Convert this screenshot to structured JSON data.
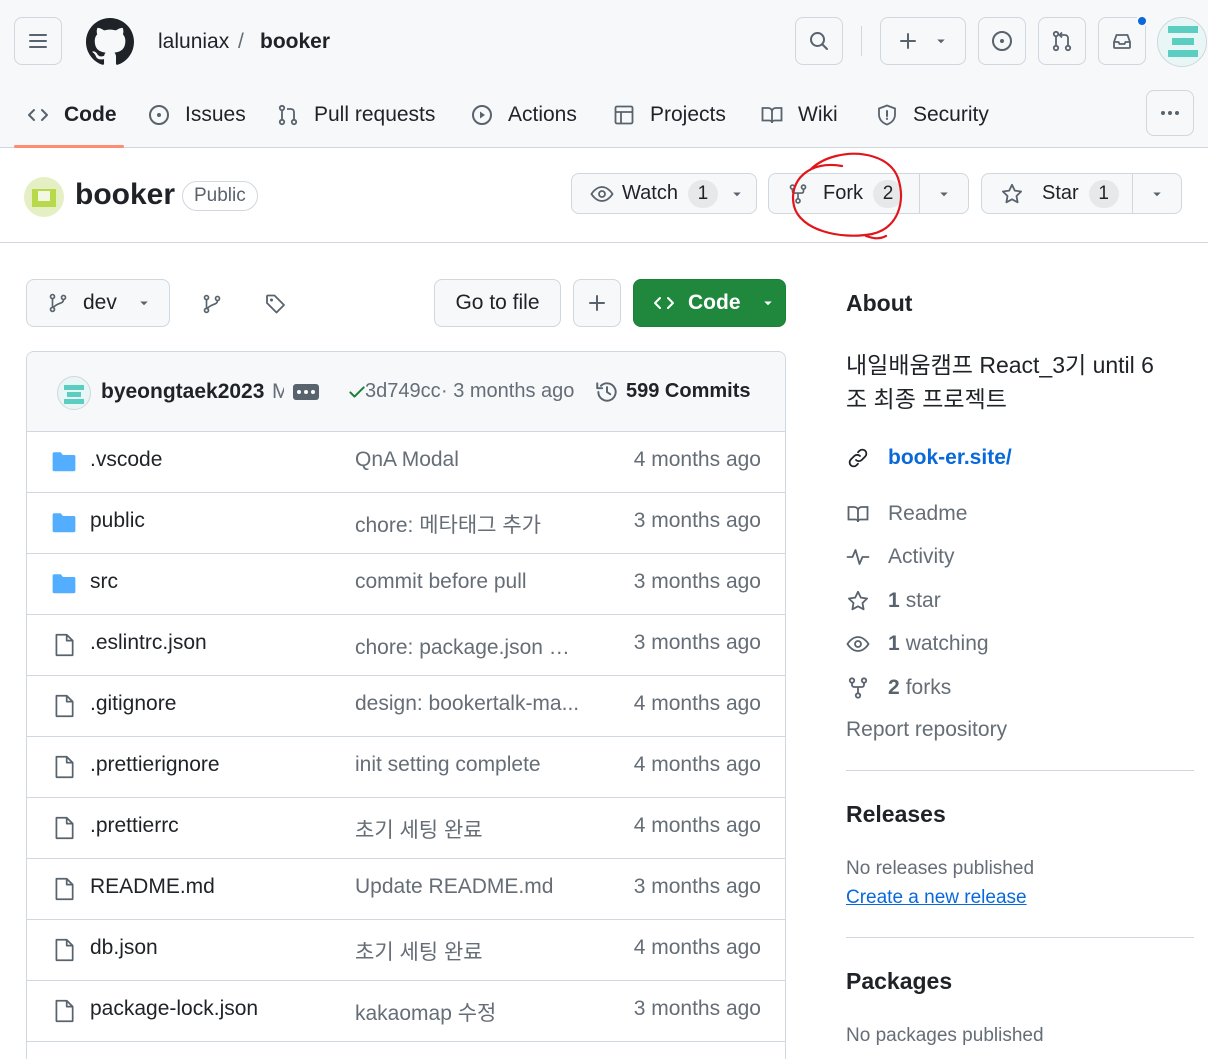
{
  "header": {
    "owner": "laluniax",
    "separator": "/",
    "repo": "booker"
  },
  "nav": {
    "tabs": [
      {
        "label": "Code"
      },
      {
        "label": "Issues"
      },
      {
        "label": "Pull requests"
      },
      {
        "label": "Actions"
      },
      {
        "label": "Projects"
      },
      {
        "label": "Wiki"
      },
      {
        "label": "Security"
      }
    ]
  },
  "repo": {
    "name": "booker",
    "visibility": "Public",
    "watch_label": "Watch",
    "watch_count": "1",
    "fork_label": "Fork",
    "fork_count": "2",
    "star_label": "Star",
    "star_count": "1"
  },
  "toolbar": {
    "branch": "dev",
    "go_to_file": "Go to file",
    "code_label": "Code"
  },
  "commit": {
    "author": "byeongtaek2023",
    "truncated": "M",
    "hash": "3d749cc",
    "time": "· 3 months ago",
    "count_label": "599 Commits"
  },
  "files": [
    {
      "name": ".vscode",
      "type": "dir",
      "message": "QnA Modal",
      "age": "4 months ago"
    },
    {
      "name": "public",
      "type": "dir",
      "message": "chore: 메타태그 추가",
      "age": "3 months ago"
    },
    {
      "name": "src",
      "type": "dir",
      "message": "commit before pull",
      "age": "3 months ago"
    },
    {
      "name": ".eslintrc.json",
      "type": "file",
      "message": "chore: package.json 정...",
      "age": "3 months ago"
    },
    {
      "name": ".gitignore",
      "type": "file",
      "message": "design: bookertalk-ma...",
      "age": "4 months ago"
    },
    {
      "name": ".prettierignore",
      "type": "file",
      "message": "init setting complete",
      "age": "4 months ago"
    },
    {
      "name": ".prettierrc",
      "type": "file",
      "message": "초기 세팅 완료",
      "age": "4 months ago"
    },
    {
      "name": "README.md",
      "type": "file",
      "message": "Update README.md",
      "age": "3 months ago"
    },
    {
      "name": "db.json",
      "type": "file",
      "message": "초기 세팅 완료",
      "age": "4 months ago"
    },
    {
      "name": "package-lock.json",
      "type": "file",
      "message": "kakaomap 수정",
      "age": "3 months ago"
    }
  ],
  "about": {
    "title": "About",
    "description_line1": "내일배움캠프 React_3기 until 6",
    "description_line2": "조 최종 프로젝트",
    "link": "book-er.site/",
    "readme": "Readme",
    "activity": "Activity",
    "stars_count": "1",
    "stars_label": "star",
    "watching_count": "1",
    "watching_label": "watching",
    "forks_count": "2",
    "forks_label": "forks",
    "report": "Report repository"
  },
  "releases": {
    "title": "Releases",
    "none": "No releases published",
    "create": "Create a new release"
  },
  "packages": {
    "title": "Packages",
    "none": "No packages published"
  },
  "colors": {
    "accent_blue": "#0969da",
    "green_button": "#1f883d",
    "folder_blue": "#54aeff",
    "annotation_red": "#e0161b",
    "tab_underline": "#fd8c73"
  }
}
